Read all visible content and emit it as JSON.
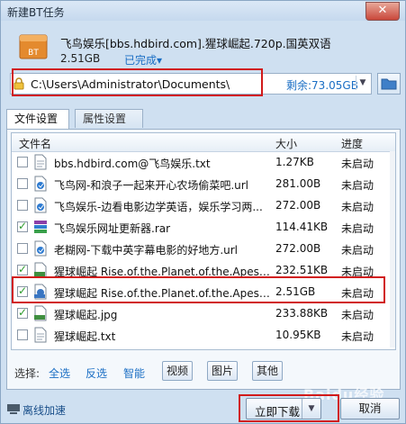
{
  "window": {
    "title": "新建BT任务",
    "close_glyph": "✕"
  },
  "task": {
    "file_badge": "BT",
    "title": "飞鸟娱乐[bbs.hdbird.com].猩球崛起.720p.国英双语",
    "size": "2.51GB",
    "status": "已完成▾"
  },
  "path": {
    "value": "C:\\Users\\Administrator\\Documents\\",
    "free_space": "剩余:73.05GB",
    "dropdown_glyph": "▼"
  },
  "tabs": [
    {
      "label": "文件设置",
      "active": true
    },
    {
      "label": "属性设置",
      "active": false
    }
  ],
  "columns": {
    "name": "文件名",
    "size": "大小",
    "progress": "进度"
  },
  "files": [
    {
      "name": "bbs.hdbird.com@飞鸟娱乐.txt",
      "size": "1.27KB",
      "progress": "未启动",
      "checked": false,
      "icon": "txt-file-icon"
    },
    {
      "name": "飞鸟网-和浪子一起来开心农场偷菜吧.url",
      "size": "281.00B",
      "progress": "未启动",
      "checked": false,
      "icon": "url-file-icon"
    },
    {
      "name": "飞鸟娱乐-边看电影边学英语，娱乐学习两...",
      "size": "272.00B",
      "progress": "未启动",
      "checked": false,
      "icon": "url-file-icon"
    },
    {
      "name": "飞鸟娱乐网址更新器.rar",
      "size": "114.41KB",
      "progress": "未启动",
      "checked": true,
      "icon": "rar-file-icon"
    },
    {
      "name": "老糊网-下载中英字幕电影的好地方.url",
      "size": "272.00B",
      "progress": "未启动",
      "checked": false,
      "icon": "url-file-icon"
    },
    {
      "name": "猩球崛起 Rise.of.the.Planet.of.the.Apes.2...",
      "size": "232.51KB",
      "progress": "未启动",
      "checked": true,
      "icon": "jpg-file-icon"
    },
    {
      "name": "猩球崛起 Rise.of.the.Planet.of.the.Apes.2...",
      "size": "2.51GB",
      "progress": "未启动",
      "checked": true,
      "icon": "mkv-file-icon"
    },
    {
      "name": "猩球崛起.jpg",
      "size": "233.88KB",
      "progress": "未启动",
      "checked": true,
      "icon": "jpg-file-icon"
    },
    {
      "name": "猩球崛起.txt",
      "size": "10.95KB",
      "progress": "未启动",
      "checked": false,
      "icon": "txt-file-icon"
    }
  ],
  "filter": {
    "label": "选择:",
    "links": [
      "全选",
      "反选",
      "智能"
    ],
    "buttons": [
      "视频",
      "图片",
      "其他"
    ]
  },
  "footer": {
    "offline": "离线加速",
    "download": "立即下载",
    "download_arrow": "▼",
    "cancel": "取消",
    "watermark": "Baidu经验"
  },
  "colors": {
    "accent_link": "#1a6ec4",
    "highlight_red": "#d11a1a",
    "window_bg": "#cfe0f1"
  }
}
